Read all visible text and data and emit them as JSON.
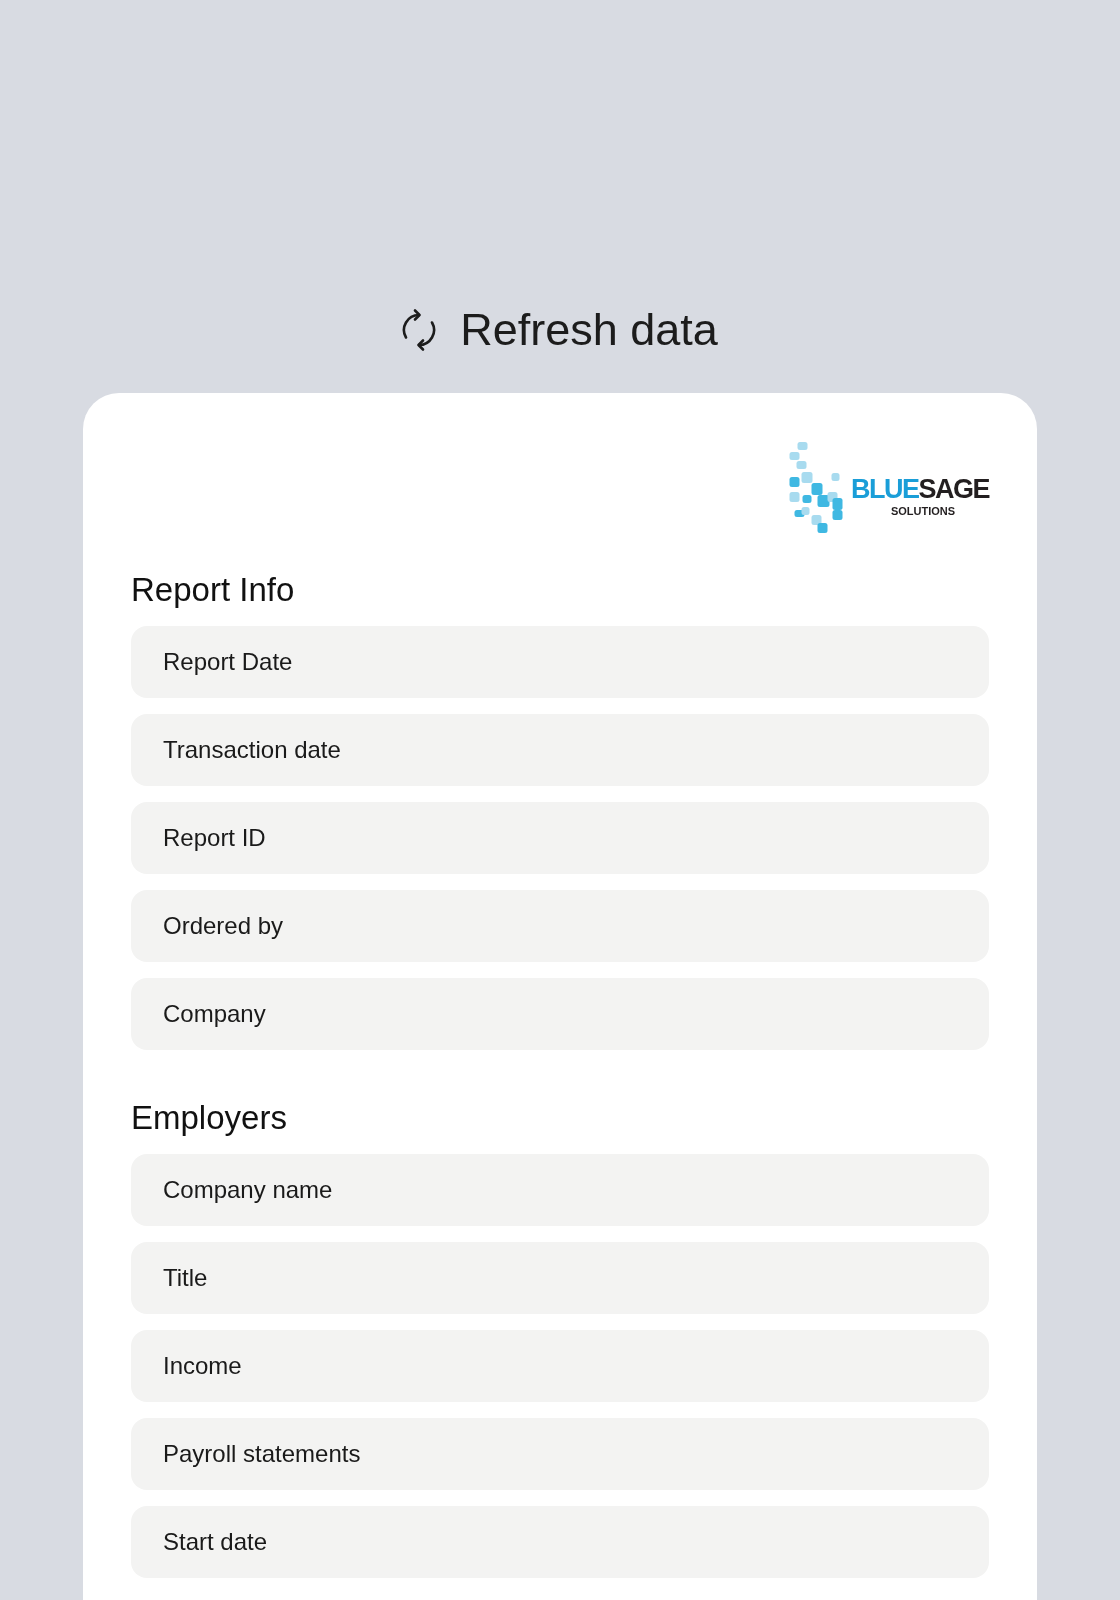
{
  "header": {
    "refresh_label": "Refresh data"
  },
  "logo": {
    "wordmark": [
      {
        "text": "BLUE",
        "color": "#1a9ed8"
      },
      {
        "text": "SAGE",
        "color": "#231f20"
      }
    ],
    "tagline": "SOLUTIONS"
  },
  "sections": [
    {
      "title": "Report Info",
      "fields": [
        {
          "label": "Report Date"
        },
        {
          "label": "Transaction date"
        },
        {
          "label": "Report ID"
        },
        {
          "label": "Ordered by"
        },
        {
          "label": "Company"
        }
      ]
    },
    {
      "title": "Employers",
      "fields": [
        {
          "label": "Company name"
        },
        {
          "label": "Title"
        },
        {
          "label": "Income"
        },
        {
          "label": "Payroll statements"
        },
        {
          "label": "Start date"
        }
      ]
    }
  ]
}
